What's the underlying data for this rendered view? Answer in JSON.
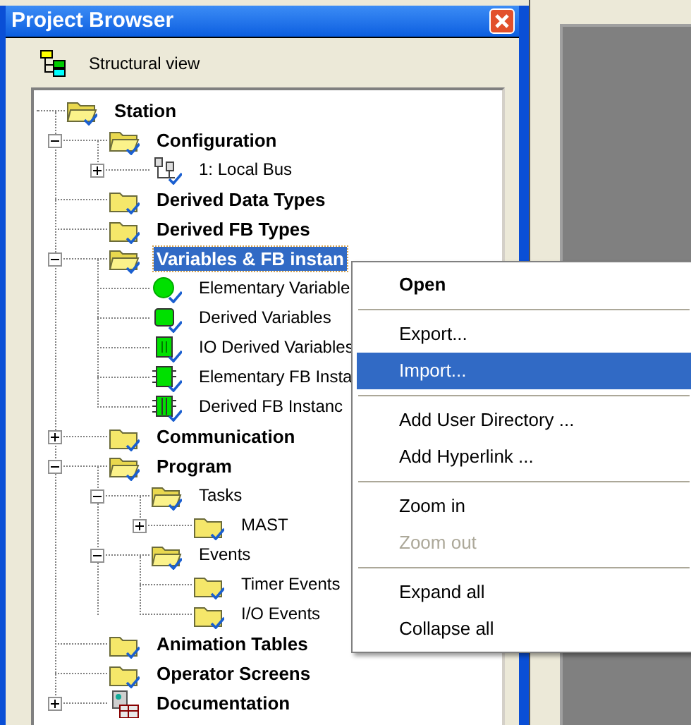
{
  "window": {
    "title": "Project Browser"
  },
  "toolbar": {
    "view_label": "Structural view"
  },
  "tree": [
    {
      "label": "Station",
      "kind": "folder-open",
      "children": [
        {
          "label": "Configuration",
          "kind": "folder-open",
          "expanded": true,
          "children": [
            {
              "label": "1: Local Bus",
              "kind": "bus",
              "expanded": false
            }
          ]
        },
        {
          "label": "Derived Data Types",
          "kind": "folder"
        },
        {
          "label": "Derived FB Types",
          "kind": "folder"
        },
        {
          "label": "Variables & FB instan",
          "kind": "folder-open",
          "expanded": true,
          "selected": true,
          "children": [
            {
              "label": "Elementary Variable",
              "kind": "circle",
              "selected": false
            },
            {
              "label": "Derived Variables",
              "kind": "square",
              "selected": false
            },
            {
              "label": "IO Derived Variables",
              "kind": "io",
              "selected": false
            },
            {
              "label": "Elementary FB Insta",
              "kind": "fb",
              "selected": false
            },
            {
              "label": "Derived FB Instanc",
              "kind": "fb2",
              "selected": false
            }
          ]
        },
        {
          "label": "Communication",
          "kind": "folder",
          "expanded": false
        },
        {
          "label": "Program",
          "kind": "folder-open",
          "expanded": true,
          "children": [
            {
              "label": "Tasks",
              "kind": "folder-open",
              "expanded": true,
              "children": [
                {
                  "label": "MAST",
                  "kind": "folder",
                  "expanded": false
                }
              ]
            },
            {
              "label": "Events",
              "kind": "folder-open",
              "expanded": true,
              "children": [
                {
                  "label": "Timer Events",
                  "kind": "folder"
                },
                {
                  "label": "I/O Events",
                  "kind": "folder"
                }
              ]
            }
          ]
        },
        {
          "label": "Animation Tables",
          "kind": "folder"
        },
        {
          "label": "Operator Screens",
          "kind": "folder"
        },
        {
          "label": "Documentation",
          "kind": "doc",
          "expanded": false
        }
      ]
    }
  ],
  "context_menu": [
    {
      "kind": "item",
      "label": "Open",
      "default": true,
      "selected": false,
      "disabled": false
    },
    {
      "kind": "separator"
    },
    {
      "kind": "item",
      "label": "Export...",
      "default": false,
      "selected": false,
      "disabled": false
    },
    {
      "kind": "item",
      "label": "Import...",
      "default": false,
      "selected": true,
      "disabled": false
    },
    {
      "kind": "separator"
    },
    {
      "kind": "item",
      "label": "Add User Directory ...",
      "default": false,
      "selected": false,
      "disabled": false
    },
    {
      "kind": "item",
      "label": "Add Hyperlink ...",
      "default": false,
      "selected": false,
      "disabled": false
    },
    {
      "kind": "separator"
    },
    {
      "kind": "item",
      "label": "Zoom in",
      "default": false,
      "selected": false,
      "disabled": false
    },
    {
      "kind": "item",
      "label": "Zoom out",
      "default": false,
      "selected": false,
      "disabled": true
    },
    {
      "kind": "separator"
    },
    {
      "kind": "item",
      "label": "Expand all",
      "default": false,
      "selected": false,
      "disabled": false
    },
    {
      "kind": "item",
      "label": "Collapse all",
      "default": false,
      "selected": false,
      "disabled": false
    }
  ]
}
